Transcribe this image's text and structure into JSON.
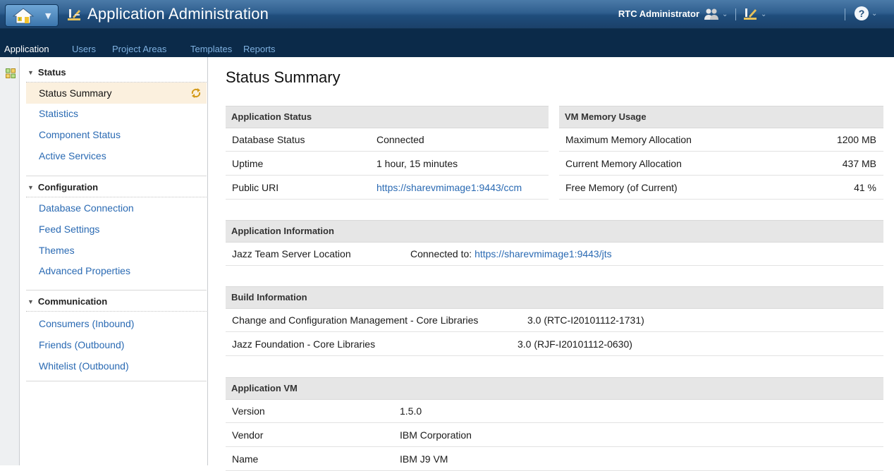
{
  "app": {
    "title": "Application Administration",
    "user": "RTC Administrator",
    "help": "?"
  },
  "nav": [
    "Application",
    "Users",
    "Project Areas",
    "Templates",
    "Reports"
  ],
  "sidebar": {
    "sections": [
      {
        "title": "Status",
        "items": [
          "Status Summary",
          "Statistics",
          "Component Status",
          "Active Services"
        ]
      },
      {
        "title": "Configuration",
        "items": [
          "Database Connection",
          "Feed Settings",
          "Themes",
          "Advanced Properties"
        ]
      },
      {
        "title": "Communication",
        "items": [
          "Consumers (Inbound)",
          "Friends (Outbound)",
          "Whitelist (Outbound)"
        ]
      }
    ],
    "selected": "Status Summary"
  },
  "main": {
    "title": "Status Summary",
    "app_status": {
      "heading": "Application Status",
      "rows": [
        {
          "label": "Database Status",
          "value": "Connected"
        },
        {
          "label": "Uptime",
          "value": "1 hour, 15 minutes"
        },
        {
          "label": "Public URI",
          "value": "https://sharevmimage1:9443/ccm"
        }
      ]
    },
    "vm_memory": {
      "heading": "VM Memory Usage",
      "rows": [
        {
          "label": "Maximum Memory Allocation",
          "value": "1200 MB"
        },
        {
          "label": "Current Memory Allocation",
          "value": "437 MB"
        },
        {
          "label": "Free Memory (of Current)",
          "value": "41 %"
        }
      ]
    },
    "app_info": {
      "heading": "Application Information",
      "label": "Jazz Team Server Location",
      "prefix": "Connected to: ",
      "link": "https://sharevmimage1:9443/jts"
    },
    "build_info": {
      "heading": "Build Information",
      "rows": [
        {
          "label": "Change and Configuration Management - Core Libraries",
          "value": "3.0 (RTC-I20101112-1731)"
        },
        {
          "label": "Jazz Foundation - Core Libraries",
          "value": "3.0 (RJF-I20101112-0630)"
        }
      ]
    },
    "app_vm": {
      "heading": "Application VM",
      "rows": [
        {
          "label": "Version",
          "value": "1.5.0"
        },
        {
          "label": "Vendor",
          "value": "IBM Corporation"
        },
        {
          "label": "Name",
          "value": "IBM J9 VM"
        }
      ]
    }
  },
  "colors": {
    "banner": "#1f4d7c",
    "nav_bg": "#0b2a49",
    "link": "#2a6ab3",
    "selected_bg": "#fbf0de",
    "panel_head": "#e6e6e6"
  }
}
